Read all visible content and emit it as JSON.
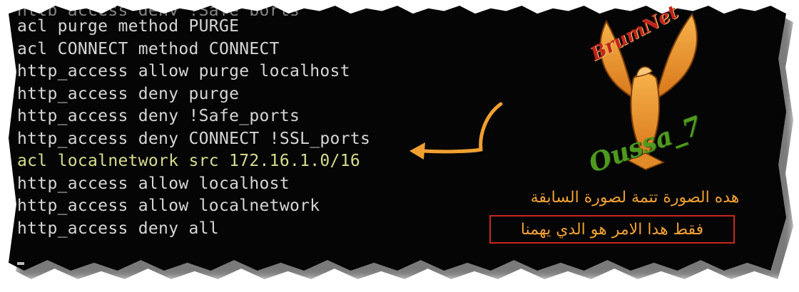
{
  "terminal": {
    "lines": [
      {
        "text": "http_access deny !Safe_ports",
        "style": "partial"
      },
      {
        "text": "acl purge method PURGE",
        "style": "normal"
      },
      {
        "text": "acl CONNECT method CONNECT",
        "style": "normal"
      },
      {
        "text": "http_access allow purge localhost",
        "style": "normal"
      },
      {
        "text": "http_access deny purge",
        "style": "normal"
      },
      {
        "text": "http_access deny !Safe_ports",
        "style": "normal"
      },
      {
        "text": "http_access deny CONNECT !SSL_ports",
        "style": "normal"
      },
      {
        "text": "acl localnetwork src 172.16.1.0/16",
        "style": "highlight"
      },
      {
        "text": "http_access allow localhost",
        "style": "normal"
      },
      {
        "text": "http_access allow localnetwork",
        "style": "normal"
      },
      {
        "text": "http_access deny all",
        "style": "normal"
      }
    ]
  },
  "watermark": {
    "brand": "BrumNet",
    "name": "Oussa_7"
  },
  "annotation": {
    "caption": "هده الصورة تتمة لصورة السابقة",
    "note": "فقط هدا الامر هو الدي يهمنا"
  },
  "colors": {
    "background": "#050505",
    "text": "#d6d6d6",
    "highlight": "#d8dc8c",
    "arrow": "#f0a030",
    "box": "#c6281e"
  },
  "icons": [
    "eagle-logo-icon",
    "arrow-icon"
  ]
}
